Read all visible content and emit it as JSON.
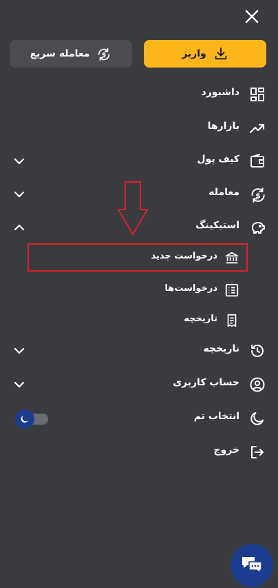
{
  "header": {
    "close_icon": "close-icon"
  },
  "actions": {
    "deposit_label": "واریز",
    "deposit_color": "#fcb61a",
    "quick_trade_label": "معامله سریع"
  },
  "menu": {
    "items": [
      {
        "label": "داشبورد",
        "icon": "dashboard-icon"
      },
      {
        "label": "بازارها",
        "icon": "trending-up-icon"
      },
      {
        "label": "کیف پول",
        "icon": "wallet-icon"
      },
      {
        "label": "معامله",
        "icon": "exchange-icon"
      },
      {
        "label": "استیکینگ",
        "icon": "piggy-bank-icon"
      },
      {
        "label": "تاریخچه",
        "icon": "history-icon"
      },
      {
        "label": "حساب کاربری",
        "icon": "user-icon"
      },
      {
        "label": "انتخاب تم",
        "icon": "moon-icon"
      },
      {
        "label": "خروج",
        "icon": "logout-icon"
      }
    ],
    "staking_sub": [
      {
        "label": "درخواست جدید",
        "icon": "bank-icon"
      },
      {
        "label": "درخواست‌ها",
        "icon": "list-icon"
      },
      {
        "label": "تاریخچه",
        "icon": "receipt-icon"
      }
    ]
  },
  "theme_toggle": {
    "state": "dark"
  },
  "colors": {
    "background": "#3a3b3f",
    "accent_yellow": "#fcb61a",
    "accent_blue": "#1a3d8f",
    "annotation_red": "#d8232a"
  }
}
